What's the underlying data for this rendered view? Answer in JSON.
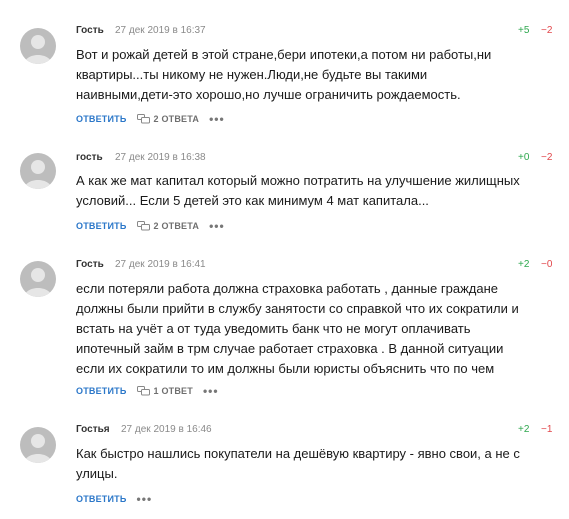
{
  "comments": [
    {
      "author": "Гость",
      "time": "27 дек 2019 в 16:37",
      "up": "+5",
      "down": "−2",
      "lines": [
        "Вот и рожай детей в этой стране,бери ипотеки,а потом ни работы,ни",
        "квартиры...ты никому не нужен.Люди,не будьте вы такими",
        "наивными,дети-это хорошо,но лучше ограничить рождаемость."
      ],
      "reply": "ОТВЕТИТЬ",
      "replies": "2 ОТВЕТА",
      "more": "•••"
    },
    {
      "author": "гость",
      "time": "27 дек 2019 в 16:38",
      "up": "+0",
      "down": "−2",
      "lines": [
        "А как же мат капитал который можно потратить на улучшение жилищных",
        "условий... Если 5 детей это как минимум 4 мат капитала..."
      ],
      "reply": "ОТВЕТИТЬ",
      "replies": "2 ОТВЕТА",
      "more": "•••"
    },
    {
      "author": "Гость",
      "time": "27 дек 2019 в 16:41",
      "up": "+2",
      "down": "−0",
      "lines": [
        "если потеряли работа должна страховка работать , данные граждане",
        "должны были прийти в службу занятости со справкой что их сократили и",
        "встать на учёт а от туда уведомить банк что не могут оплачивать",
        "ипотечный займ в трм случае работает страховка . В данной ситуации",
        "если их сократили то им должны были юристы объяснить что по чем"
      ],
      "reply": "ОТВЕТИТЬ",
      "replies": "1 ОТВЕТ",
      "more": "•••"
    },
    {
      "author": "Гостья",
      "time": "27 дек 2019 в 16:46",
      "up": "+2",
      "down": "−1",
      "lines": [
        "Как быстро нашлись покупатели на дешёвую квартиру - явно свои, а не с",
        "улицы."
      ],
      "reply": "ОТВЕТИТЬ",
      "replies": "",
      "more": "•••"
    }
  ],
  "icons": {
    "avatar": "user-avatar-placeholder",
    "replies": "speech-bubbles-icon",
    "more": "more-dots-icon"
  },
  "colors": {
    "accent": "#2b77c9",
    "up": "#2fa84f",
    "down": "#e2474b",
    "avatar": "#bdbdbd"
  }
}
